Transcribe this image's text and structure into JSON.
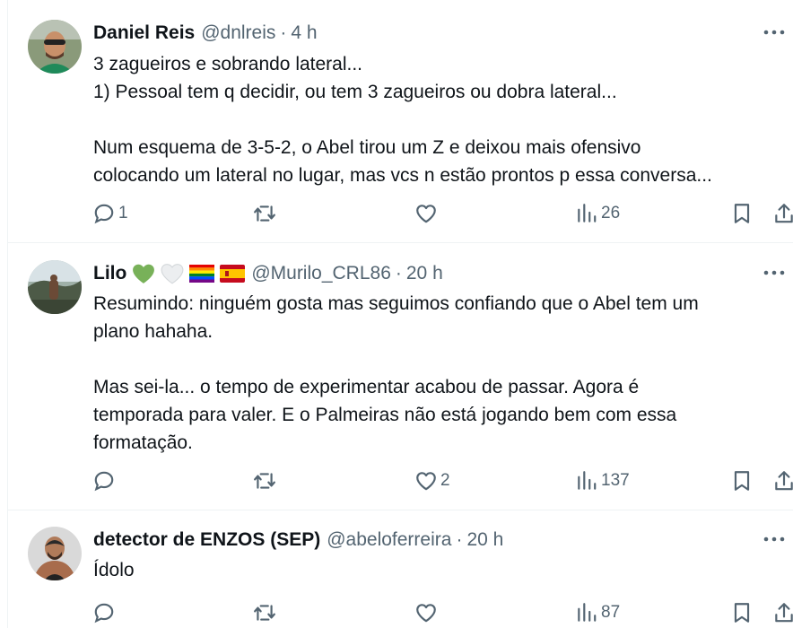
{
  "tweets": [
    {
      "name": "Daniel Reis",
      "handle": "@dnlreis",
      "separator": "·",
      "time": "4 h",
      "lines": [
        "3 zagueiros e sobrando lateral...",
        "1) Pessoal tem q decidir, ou tem 3 zagueiros ou dobra lateral...",
        "",
        "Num esquema de 3-5-2, o Abel tirou um Z e deixou mais ofensivo",
        "colocando um lateral no lugar, mas vcs n estão prontos p essa conversa..."
      ],
      "replies": "1",
      "retweets": "",
      "likes": "",
      "views": "26"
    },
    {
      "name": "Lilo",
      "handle": "@Murilo_CRL86",
      "separator": "·",
      "time": "20 h",
      "name_emojis": [
        "green-heart",
        "white-heart",
        "rainbow-flag",
        "spain-flag"
      ],
      "lines": [
        "Resumindo: ninguém gosta mas seguimos confiando que o Abel tem um",
        "plano hahaha.",
        "",
        "Mas sei-la... o tempo de experimentar acabou de passar. Agora é",
        "temporada para valer. E o Palmeiras não está jogando bem com essa",
        "formatação."
      ],
      "replies": "",
      "retweets": "",
      "likes": "2",
      "views": "137"
    },
    {
      "name": "detector de ENZOS (SEP)",
      "handle": "@abeloferreira",
      "separator": "·",
      "time": "20 h",
      "lines": [
        "Ídolo"
      ],
      "replies": "",
      "retweets": "",
      "likes": "",
      "views": "87"
    }
  ],
  "colors": {
    "text": "#0f1419",
    "secondary": "#536471",
    "divider": "#eff3f4",
    "green_heart": "#78b159",
    "white_heart": "#e8eaed"
  },
  "icons": {
    "reply": "reply-icon",
    "retweet": "retweet-icon",
    "like": "heart-icon",
    "views": "views-icon",
    "bookmark": "bookmark-icon",
    "share": "share-icon",
    "more": "more-icon"
  }
}
